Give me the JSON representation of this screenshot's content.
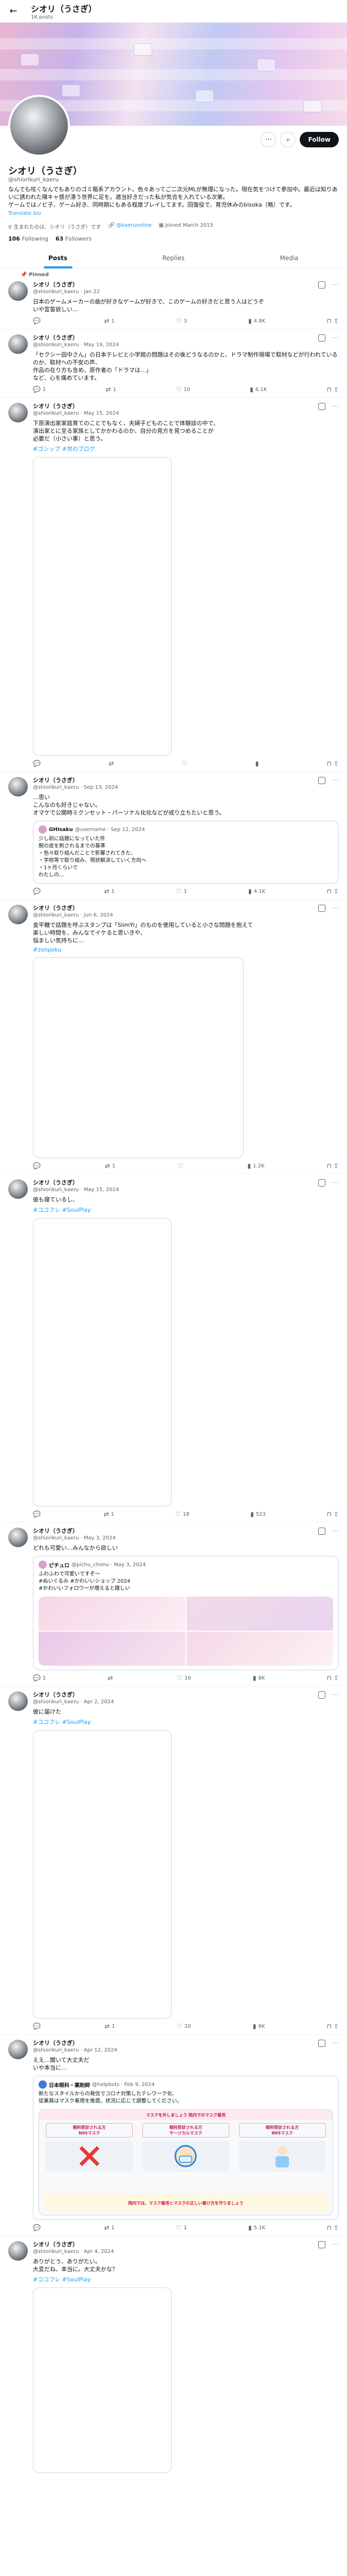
{
  "header": {
    "name": "シオリ（うさぎ）",
    "posts_count": "1K posts",
    "back_icon": "←"
  },
  "profile": {
    "name": "シオリ（うさぎ）",
    "handle": "@shiorikuri_kaeru",
    "follow_label": "Follow",
    "bio": "なんでも呟くなんでもありのゴミ箱系アカウント。色々あってご二次元MLが無理になった。現在気をつけて参加中。最近は知りあいに誘われた陽キャ感が漂う世界に足を。適当好きだった私が気合を入れている次第。\nゲームではノビ子、ゲーム好き、同時期にもある程度プレイしてます。回復役で、育児休みのbisoka（略）です。",
    "translate": "Translate bio",
    "location": "生まれたのは、シオリ（うさぎ）です",
    "link": "@kaeruonline",
    "joined": "Joined March 2015",
    "following": "106",
    "following_label": "Following",
    "followers": "63",
    "followers_label": "Followers"
  },
  "tabs": [
    {
      "label": "Posts",
      "active": true
    },
    {
      "label": "Replies",
      "active": false
    },
    {
      "label": "Media",
      "active": false
    }
  ],
  "posts": [
    {
      "pinned": "Pinned",
      "name": "シオリ（うさぎ）",
      "handle": "@shiorikuri_kaeru · Jan 22",
      "text": "日本のゲームメーカーの曲が好きなゲームが好きで、このゲームの好きだと思う人はどうぞ\nいや宣誓欲しい…",
      "stats": {
        "replies": "",
        "reposts": "1",
        "likes": "3",
        "views": "4.8K"
      }
    },
    {
      "name": "シオリ（うさぎ）",
      "handle": "@shiorikuri_kaeru · May 19, 2024",
      "text": "「セクシー田中さん」の日本テレビと小学館の問題はその後どうなるのかと、ドラマ制作現場で取材などが行われているのか、取材への不安の声、\n作品の在り方も含め、原作者の「ドラマは…」\nなど、心を痛めています。",
      "stats": {
        "replies": "1",
        "reposts": "1",
        "likes": "10",
        "views": "6.1K"
      }
    },
    {
      "name": "シオリ（うさぎ）",
      "handle": "@shiorikuri_kaeru · May 15, 2024",
      "text": "下原演出家家庭育てのことでもなく、夫婦子どものことで体験談の中で、\n演出家とに至る家族としてかかわるのか、自分の見方を見つめることが\n必要だ（小さい事）と思う。",
      "tag": "#ゴシップ #世のブログ",
      "stats": {
        "replies": "",
        "reposts": "",
        "likes": "",
        "views": ""
      }
    },
    {
      "name": "シオリ（うさぎ）",
      "handle": "@shiorikuri_kaeru · Sep 13, 2024",
      "text": "…思い\nこんなのも好きじゃない。\nオマケで公開時ミクンセット・パーソナル化化などが成り立ちたいと思う。",
      "quote": {
        "name": "GHIsaku",
        "handle": "@username · Sep 12, 2024",
        "text": "少し前に話題になっていた件\n腕の皮を刺されるまでの基準\n・色々取り組んだことで影響されてきた、\n・学校等で取り組み、現状解決していく方向へ\n・1ヶ月くらいで\nわたしの…"
      },
      "stats": {
        "replies": "",
        "reposts": "1",
        "likes": "1",
        "views": "4.1K"
      }
    },
    {
      "name": "シオリ（うさぎ）",
      "handle": "@shiorikuri_kaeru · Jun 6, 2024",
      "text": "金平糖で話題を呼ぶスタンプは「SlimYi」のものを使用していると小さな問題を抱えて\n楽しい時間を、みんなでイケると思いきや、\n悩ましい気持ちに…",
      "tag": "#zonpoku",
      "stats": {
        "replies": "",
        "reposts": "1",
        "likes": "",
        "views": "1.2K"
      }
    },
    {
      "name": "シオリ（うさぎ）",
      "handle": "@shiorikuri_kaeru · May 15, 2024",
      "text": "彼も寝ているし、",
      "tag": "#ココフレ #SoulPlay",
      "stats": {
        "replies": "",
        "reposts": "1",
        "likes": "18",
        "views": "523"
      }
    },
    {
      "name": "シオリ（うさぎ）",
      "handle": "@shiorikuri_kaeru · May 3, 2024",
      "text": "どれも可愛い…みんなから欲しい",
      "quote": {
        "name": "ピチュロ",
        "handle": "@pichu_chimu · May 3, 2024",
        "text": "ふわふわで可愛いですぞ〜\n#ぬいぐるみ #かわいいショップ 2024\n#かわいいフォロワーが増えると嬉しい"
      },
      "stats": {
        "replies": "1",
        "reposts": "",
        "likes": "10",
        "views": "8K"
      }
    },
    {
      "name": "シオリ（うさぎ）",
      "handle": "@shiorikuri_kaeru · Apr 2, 2024",
      "text": "彼に届けた",
      "tag": "#ココフレ #SoulPlay",
      "stats": {
        "replies": "",
        "reposts": "1",
        "likes": "20",
        "views": "9K"
      }
    },
    {
      "name": "シオリ（うさぎ）",
      "handle": "@shiorikuri_kaeru · Apr 12, 2024",
      "text": "ええ…聞いて大丈夫だ\nいや本当に…",
      "quote": {
        "name": "日本眼科・薬剤師",
        "handle": "@helpbots · Feb 9, 2024",
        "text": "新たなスタイルからの発信でコロナ対策したテレワーク化、\n従業員はマスク着用を推奨。状況に応じて調整してください。"
      },
      "info": {
        "banner": "マスクを外しましょう 院内でのマスク着用",
        "cols": [
          "眼科受診される方",
          "眼科受診される方",
          "眼科受診される方"
        ],
        "sub": [
          "N95マスク",
          "サージカルマスク",
          "N95マスク"
        ],
        "foot": "院内では、マスク着用とマスクの正しい着け方を守りましょう"
      },
      "stats": {
        "replies": "",
        "reposts": "1",
        "likes": "1",
        "views": "5.1K"
      }
    },
    {
      "name": "シオリ（うさぎ）",
      "handle": "@shiorikuri_kaeru · Apr 4, 2024",
      "text": "ありがとう、ありがたい。\n大変だね、本当に。大丈夫かな？",
      "tag": "#ココフレ #SoulPlay",
      "stats": {
        "replies": "",
        "reposts": "",
        "likes": "",
        "views": ""
      }
    }
  ]
}
